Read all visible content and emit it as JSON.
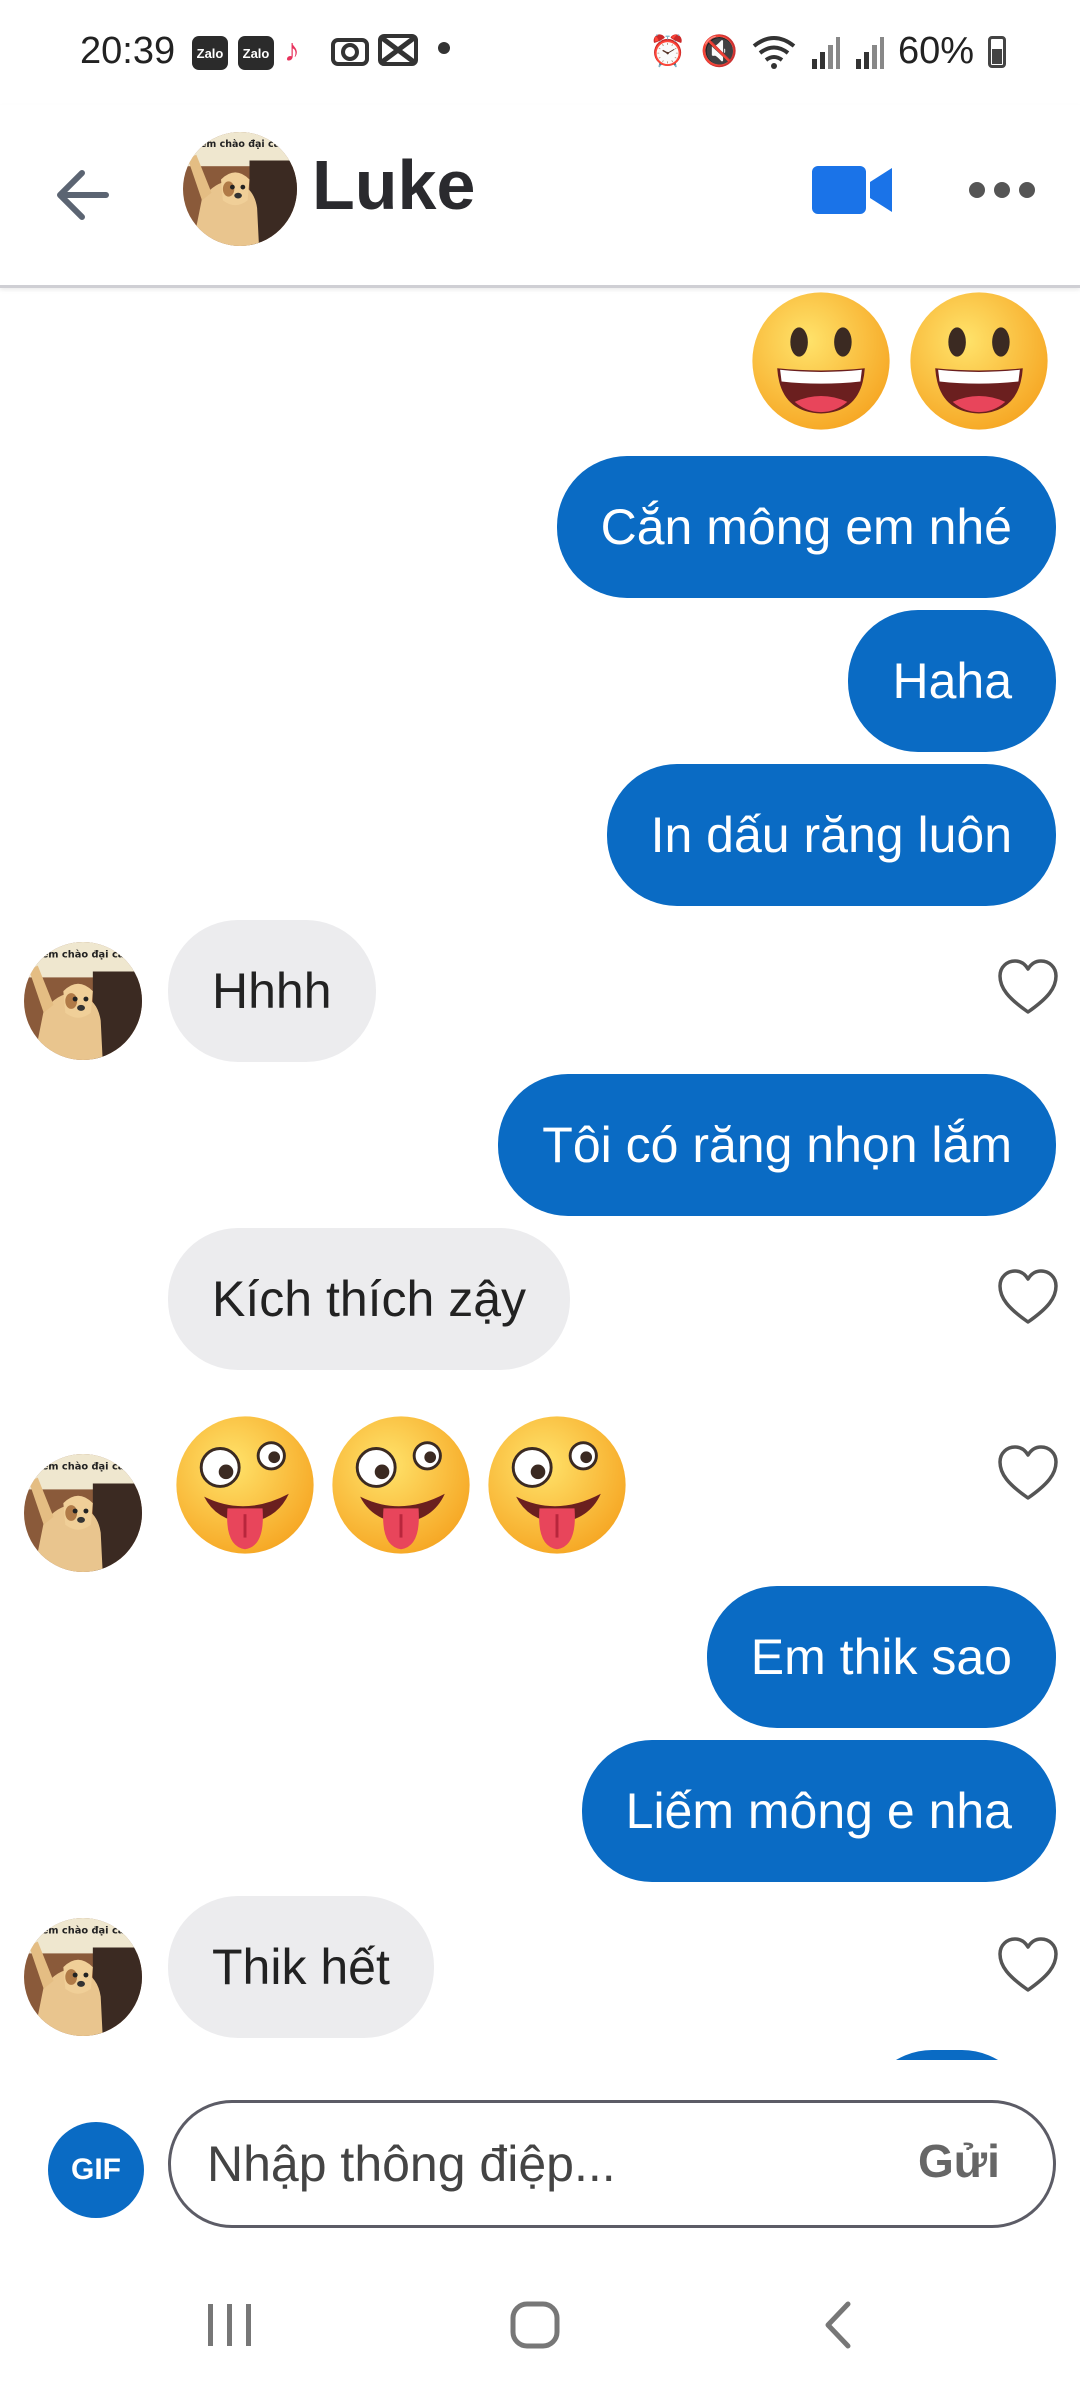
{
  "status_bar": {
    "time": "20:39",
    "apps": [
      "Zalo",
      "Zalo"
    ],
    "battery": "60%",
    "icons": [
      "tiktok-icon",
      "camera-icon",
      "capcut-icon",
      "dot-icon",
      "alarm-icon",
      "mute-icon",
      "wifi-icon",
      "signal-icon",
      "signal-icon",
      "battery-icon"
    ]
  },
  "header": {
    "contact_name": "Luke",
    "avatar_caption": "em chào đại ca",
    "icons": [
      "back-arrow-icon",
      "video-call-icon",
      "more-icon"
    ]
  },
  "messages": [
    {
      "direction": "outgoing",
      "type": "emoji",
      "emoji": "grinning-face",
      "count": 2
    },
    {
      "direction": "outgoing",
      "type": "text",
      "text": "Cắn mông em nhé"
    },
    {
      "direction": "outgoing",
      "type": "text",
      "text": "Haha"
    },
    {
      "direction": "outgoing",
      "type": "text",
      "text": "In dấu răng luôn"
    },
    {
      "direction": "incoming",
      "type": "text",
      "text": "Hhhh"
    },
    {
      "direction": "outgoing",
      "type": "text",
      "text": "Tôi có răng nhọn lắm"
    },
    {
      "direction": "incoming",
      "type": "text",
      "text": "Kích thích zậy"
    },
    {
      "direction": "incoming",
      "type": "emoji",
      "emoji": "zany-face",
      "count": 3
    },
    {
      "direction": "outgoing",
      "type": "text",
      "text": "Em thik sao"
    },
    {
      "direction": "outgoing",
      "type": "text",
      "text": "Liếm mông e nha"
    },
    {
      "direction": "incoming",
      "type": "text",
      "text": "Thik hết"
    }
  ],
  "composer": {
    "gif_label": "GIF",
    "placeholder": "Nhập thông điệp...",
    "send_label": "Gửi"
  },
  "colors": {
    "outgoing_bubble": "#0a6bc4",
    "incoming_bubble": "#ececee",
    "accent": "#1a73e8"
  }
}
